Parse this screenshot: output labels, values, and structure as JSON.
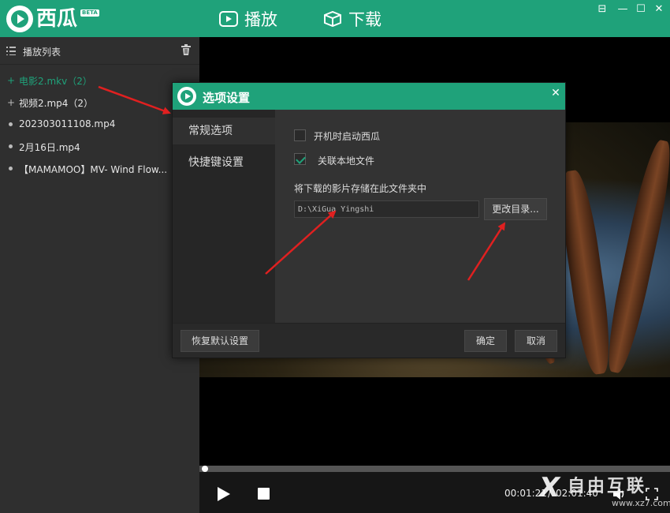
{
  "titlebar": {
    "app_name": "西瓜",
    "beta": "BETA",
    "nav_play": "播放",
    "nav_download": "下载",
    "win_menu": "⊟",
    "win_min": "—",
    "win_max": "☐",
    "win_close": "✕"
  },
  "sidebar": {
    "title": "播放列表",
    "items": [
      {
        "label": "电影2.mkv（2）",
        "bullet": "+"
      },
      {
        "label": "视频2.mp4（2）",
        "bullet": "+"
      },
      {
        "label": "202303011108.mp4",
        "bullet": ""
      },
      {
        "label": "2月16日.mp4",
        "bullet": ""
      },
      {
        "label": "【MAMAMOO】MV- Wind Flow...",
        "bullet": ""
      }
    ]
  },
  "dialog": {
    "title": "选项设置",
    "close": "✕",
    "tabs": [
      "常规选项",
      "快捷键设置"
    ],
    "options": {
      "startup_label": "开机时启动西瓜",
      "associate_label": "关联本地文件",
      "folder_label": "将下载的影片存储在此文件夹中",
      "folder_value": "D:\\XiGua Yingshi",
      "change_button": "更改目录..."
    },
    "footer": {
      "restore": "恢复默认设置",
      "ok": "确定",
      "cancel": "取消"
    }
  },
  "player": {
    "time_current": "00:01:21",
    "time_separator": "/",
    "time_total": "02:01:40",
    "progress_fraction": 0.011
  },
  "watermark": {
    "mark": "X",
    "text": "自由互联",
    "sub": "www.xz7.com"
  },
  "colors": {
    "accent": "#1fa27a",
    "annotation": "#e02020"
  }
}
